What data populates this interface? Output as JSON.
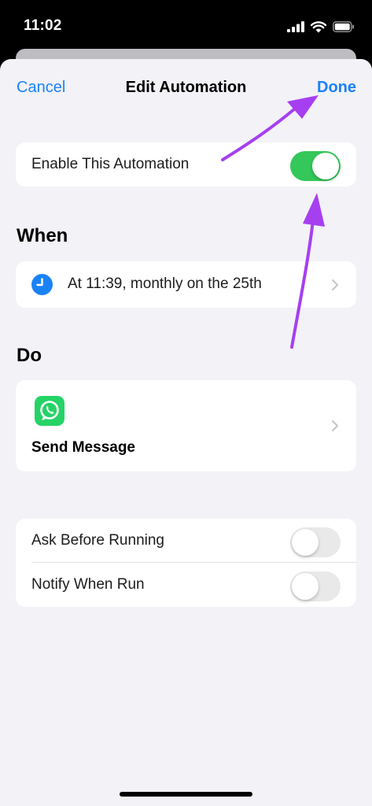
{
  "status_bar": {
    "time": "11:02",
    "icons": [
      "cellular-signal-icon",
      "wifi-icon",
      "battery-icon"
    ]
  },
  "nav": {
    "cancel": "Cancel",
    "title": "Edit Automation",
    "done": "Done"
  },
  "enable": {
    "label": "Enable This Automation",
    "on": true
  },
  "when": {
    "title": "When",
    "trigger": "At 11:39, monthly on the 25th",
    "icon": "clock-icon"
  },
  "do": {
    "title": "Do",
    "action": "Send Message",
    "icon": "whatsapp-icon"
  },
  "options": [
    {
      "label": "Ask Before Running",
      "on": false
    },
    {
      "label": "Notify When Run",
      "on": false
    }
  ],
  "colors": {
    "accent": "#1a82f7",
    "toggle_on": "#34c759",
    "annotation_arrow": "#a63ff0",
    "whatsapp": "#25d366"
  }
}
